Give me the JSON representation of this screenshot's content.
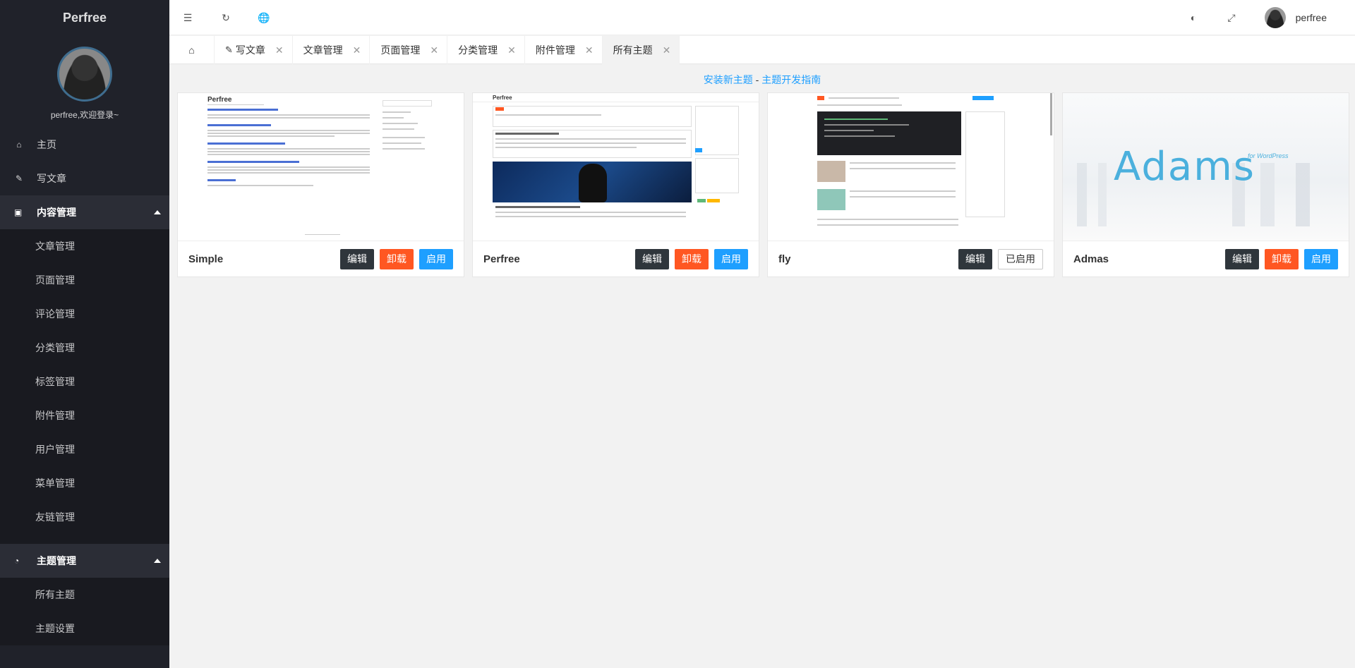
{
  "sidebar": {
    "logo": "Perfree",
    "welcome": "perfree,欢迎登录~",
    "items": [
      {
        "label": "主页",
        "icon": "home-icon"
      },
      {
        "label": "写文章",
        "icon": "edit-icon"
      }
    ],
    "content_group": {
      "label": "内容管理",
      "icon": "inbox-icon",
      "items": [
        "文章管理",
        "页面管理",
        "评论管理",
        "分类管理",
        "标签管理",
        "附件管理",
        "用户管理",
        "菜单管理",
        "友链管理"
      ]
    },
    "theme_group": {
      "label": "主题管理",
      "icon": "dashboard-icon",
      "items": [
        "所有主题",
        "主题设置"
      ]
    }
  },
  "header": {
    "icons": [
      "menu-fold-icon",
      "refresh-icon",
      "globe-icon",
      "palette-icon",
      "fullscreen-icon"
    ],
    "username": "perfree"
  },
  "tabs": [
    {
      "label": "写文章",
      "closable": true
    },
    {
      "label": "文章管理",
      "closable": true
    },
    {
      "label": "页面管理",
      "closable": true
    },
    {
      "label": "分类管理",
      "closable": true
    },
    {
      "label": "附件管理",
      "closable": true
    },
    {
      "label": "所有主题",
      "closable": true,
      "active": true
    }
  ],
  "content": {
    "install_link": "安装新主题",
    "separator": " - ",
    "guide_link": "主题开发指南"
  },
  "themes": [
    {
      "name": "Simple",
      "edit": "编辑",
      "uninstall": "卸载",
      "enable": "启用",
      "thumb_title": "Perfree"
    },
    {
      "name": "Perfree",
      "edit": "编辑",
      "uninstall": "卸载",
      "enable": "启用",
      "thumb_title": "Perfree"
    },
    {
      "name": "fly",
      "edit": "编辑",
      "enabled_label": "已启用"
    },
    {
      "name": "Admas",
      "edit": "编辑",
      "uninstall": "卸载",
      "enable": "启用",
      "thumb_title": "Adams",
      "thumb_sub": "for WordPress"
    }
  ],
  "colors": {
    "sidebar_bg": "#20222a",
    "accent_blue": "#1e9fff",
    "danger_orange": "#ff5722",
    "dark_button": "#2f363c"
  }
}
